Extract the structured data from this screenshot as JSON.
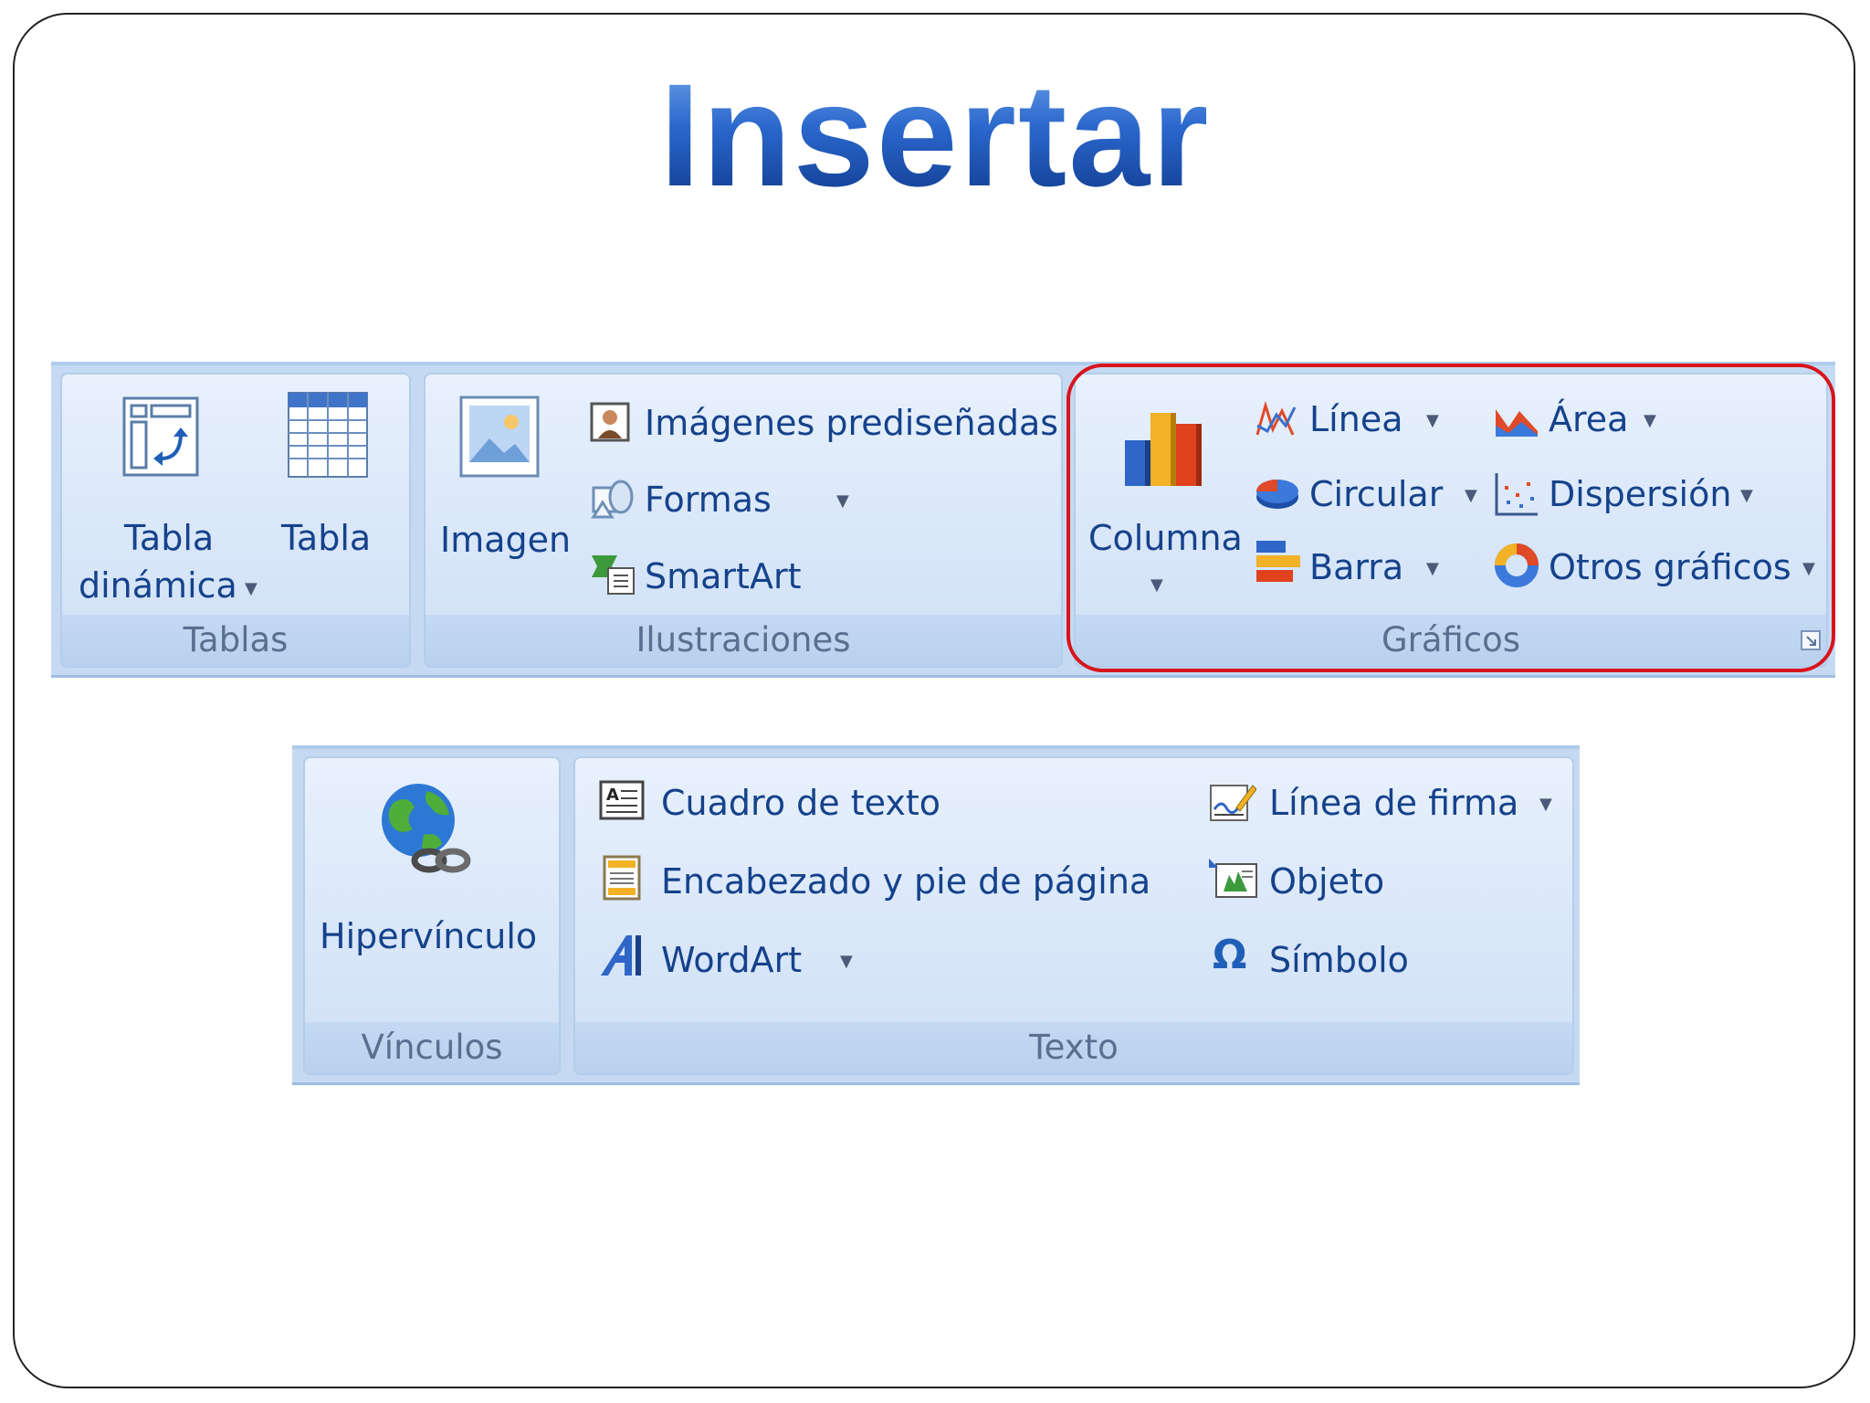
{
  "title": "Insertar",
  "ribbon1": {
    "tablas": {
      "label": "Tablas",
      "tabla_dinamica": [
        "Tabla",
        "dinámica"
      ],
      "tabla": "Tabla"
    },
    "ilustraciones": {
      "label": "Ilustraciones",
      "imagen": "Imagen",
      "imagenes_prediseñadas": "Imágenes prediseñadas",
      "formas": "Formas",
      "smartart": "SmartArt"
    },
    "graficos": {
      "label": "Gráficos",
      "columna": "Columna",
      "linea": "Línea",
      "circular": "Circular",
      "barra": "Barra",
      "area": "Área",
      "dispersion": "Dispersión",
      "otros": "Otros gráficos"
    }
  },
  "ribbon2": {
    "vinculos": {
      "label": "Vínculos",
      "hipervinculo": "Hipervínculo"
    },
    "texto": {
      "label": "Texto",
      "cuadro": "Cuadro de texto",
      "encabezado": "Encabezado y pie de página",
      "wordart": "WordArt",
      "linea_firma": "Línea de firma",
      "objeto": "Objeto",
      "simbolo": "Símbolo"
    }
  },
  "colors": {
    "highlight": "#d8141c",
    "label_text": "#15428b",
    "group_label_text": "#5a6f8f",
    "ribbon_bg": "#c5daf2"
  },
  "icons": [
    "pivot-table-icon",
    "table-icon",
    "picture-icon",
    "clipart-icon",
    "shapes-icon",
    "smartart-icon",
    "column-chart-icon",
    "line-chart-icon",
    "pie-chart-icon",
    "bar-chart-icon",
    "area-chart-icon",
    "scatter-chart-icon",
    "other-charts-icon",
    "dialog-launcher-icon",
    "globe-link-icon",
    "textbox-icon",
    "header-footer-icon",
    "wordart-icon",
    "signature-line-icon",
    "object-icon",
    "omega-icon"
  ]
}
